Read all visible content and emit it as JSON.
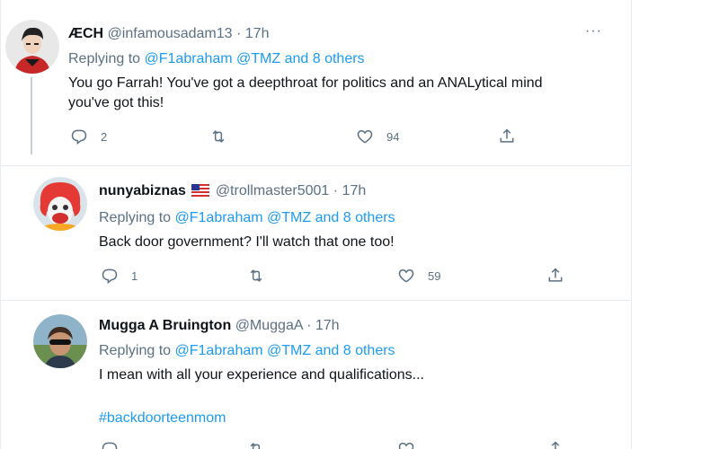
{
  "tweets": [
    {
      "display_name": "ÆCH",
      "handle": "@infamousadam13",
      "separator": "·",
      "time": "17h",
      "replying_prefix": "Replying to",
      "mentions": [
        "@F1abraham",
        "@TMZ"
      ],
      "others": "and 8 others",
      "text_lines": [
        "You go Farrah! You've got a deepthroat for politics and an ANALytical mind",
        "you've got this!"
      ],
      "replies": "2",
      "retweets": "",
      "likes": "94",
      "more": "···"
    },
    {
      "display_name": "nunyabiznas",
      "flag": "us-flag",
      "handle": "@trollmaster5001",
      "separator": "·",
      "time": "17h",
      "replying_prefix": "Replying to",
      "mentions": [
        "@F1abraham",
        "@TMZ"
      ],
      "others": "and 8 others",
      "text": "Back door government? I'll watch that one too!",
      "replies": "1",
      "retweets": "",
      "likes": "59"
    },
    {
      "display_name": "Mugga A Bruington",
      "handle": "@MuggaA",
      "separator": "·",
      "time": "17h",
      "replying_prefix": "Replying to",
      "mentions": [
        "@F1abraham",
        "@TMZ"
      ],
      "others": "and 8 others",
      "text": "I mean with all your experience and qualifications...",
      "hashtag": "#backdoorteenmom"
    }
  ],
  "colors": {
    "link": "#1d9bf0",
    "secondary_text": "#5b7083",
    "primary_text": "#0f1419",
    "divider": "#e6ecf0"
  },
  "icons": [
    "reply-icon",
    "retweet-icon",
    "like-icon",
    "share-icon",
    "more-icon",
    "us-flag"
  ]
}
